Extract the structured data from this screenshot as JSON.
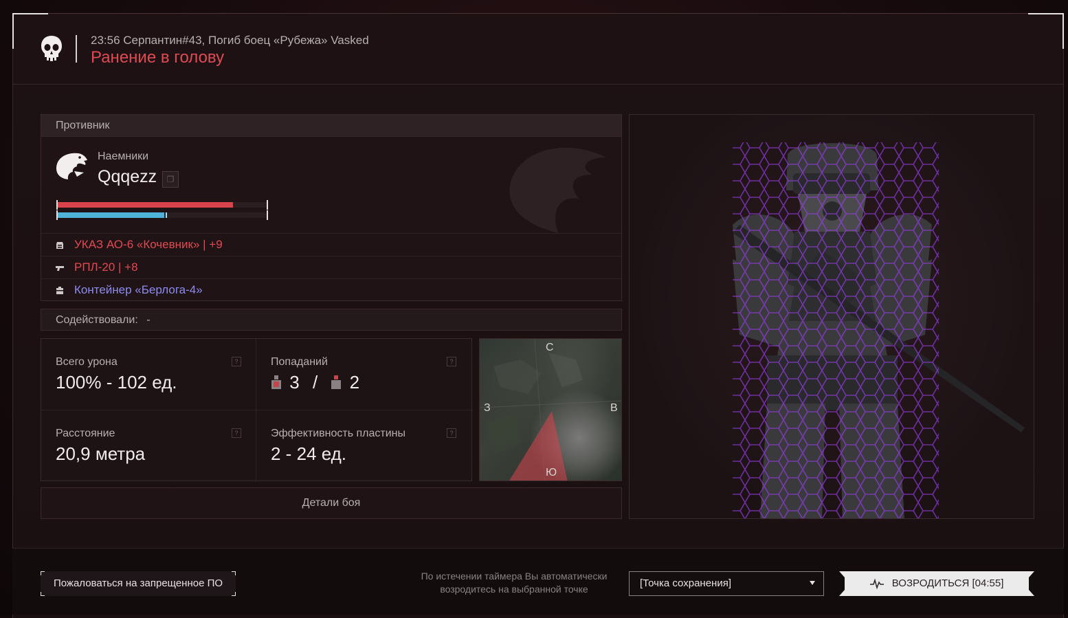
{
  "header": {
    "subtitle": "23:56 Серпантин#43, Погиб боец «Рубежа» Vasked",
    "title": "Ранение в голову"
  },
  "enemy": {
    "section_label": "Противник",
    "faction": "Наемники",
    "name": "Qqqezz",
    "health_fraction": 0.84,
    "armor_fraction": 0.51,
    "gear": [
      {
        "label": "УКАЗ АО-6 «Кочевник» | +9",
        "color": "#e14a52",
        "icon": "armor-icon"
      },
      {
        "label": "РПЛ-20 | +8",
        "color": "#e14a52",
        "icon": "weapon-icon"
      },
      {
        "label": "Контейнер «Берлога-4»",
        "color": "#8e8cf0",
        "icon": "container-icon"
      }
    ]
  },
  "assist": {
    "label": "Содействовали:",
    "value": "-"
  },
  "stats": {
    "total_damage_label": "Всего урона",
    "total_damage_value": "100% - 102 ед.",
    "hits_label": "Попаданий",
    "hits_a": "3",
    "hits_sep": "/",
    "hits_b": "2",
    "distance_label": "Расстояние",
    "distance_value": "20,9 метра",
    "plate_label": "Эффективность пластины",
    "plate_value": "2 - 24 ед.",
    "help_glyph": "?"
  },
  "minimap": {
    "north": "С",
    "south": "Ю",
    "west": "З",
    "east": "В"
  },
  "details_button": "Детали боя",
  "footer": {
    "report_button": "Пожаловаться на запрещенное ПО",
    "hint_line1": "По истечении таймера Вы автоматически",
    "hint_line2": "возродитесь на выбранной точке",
    "spawn_select": "[Точка сохранения]",
    "respawn_button": "ВОЗРОДИТЬСЯ [04:55]"
  },
  "colors": {
    "accent_red": "#e14a52",
    "health": "#d9444c",
    "armor": "#4fb3d9",
    "container": "#8e8cf0"
  }
}
